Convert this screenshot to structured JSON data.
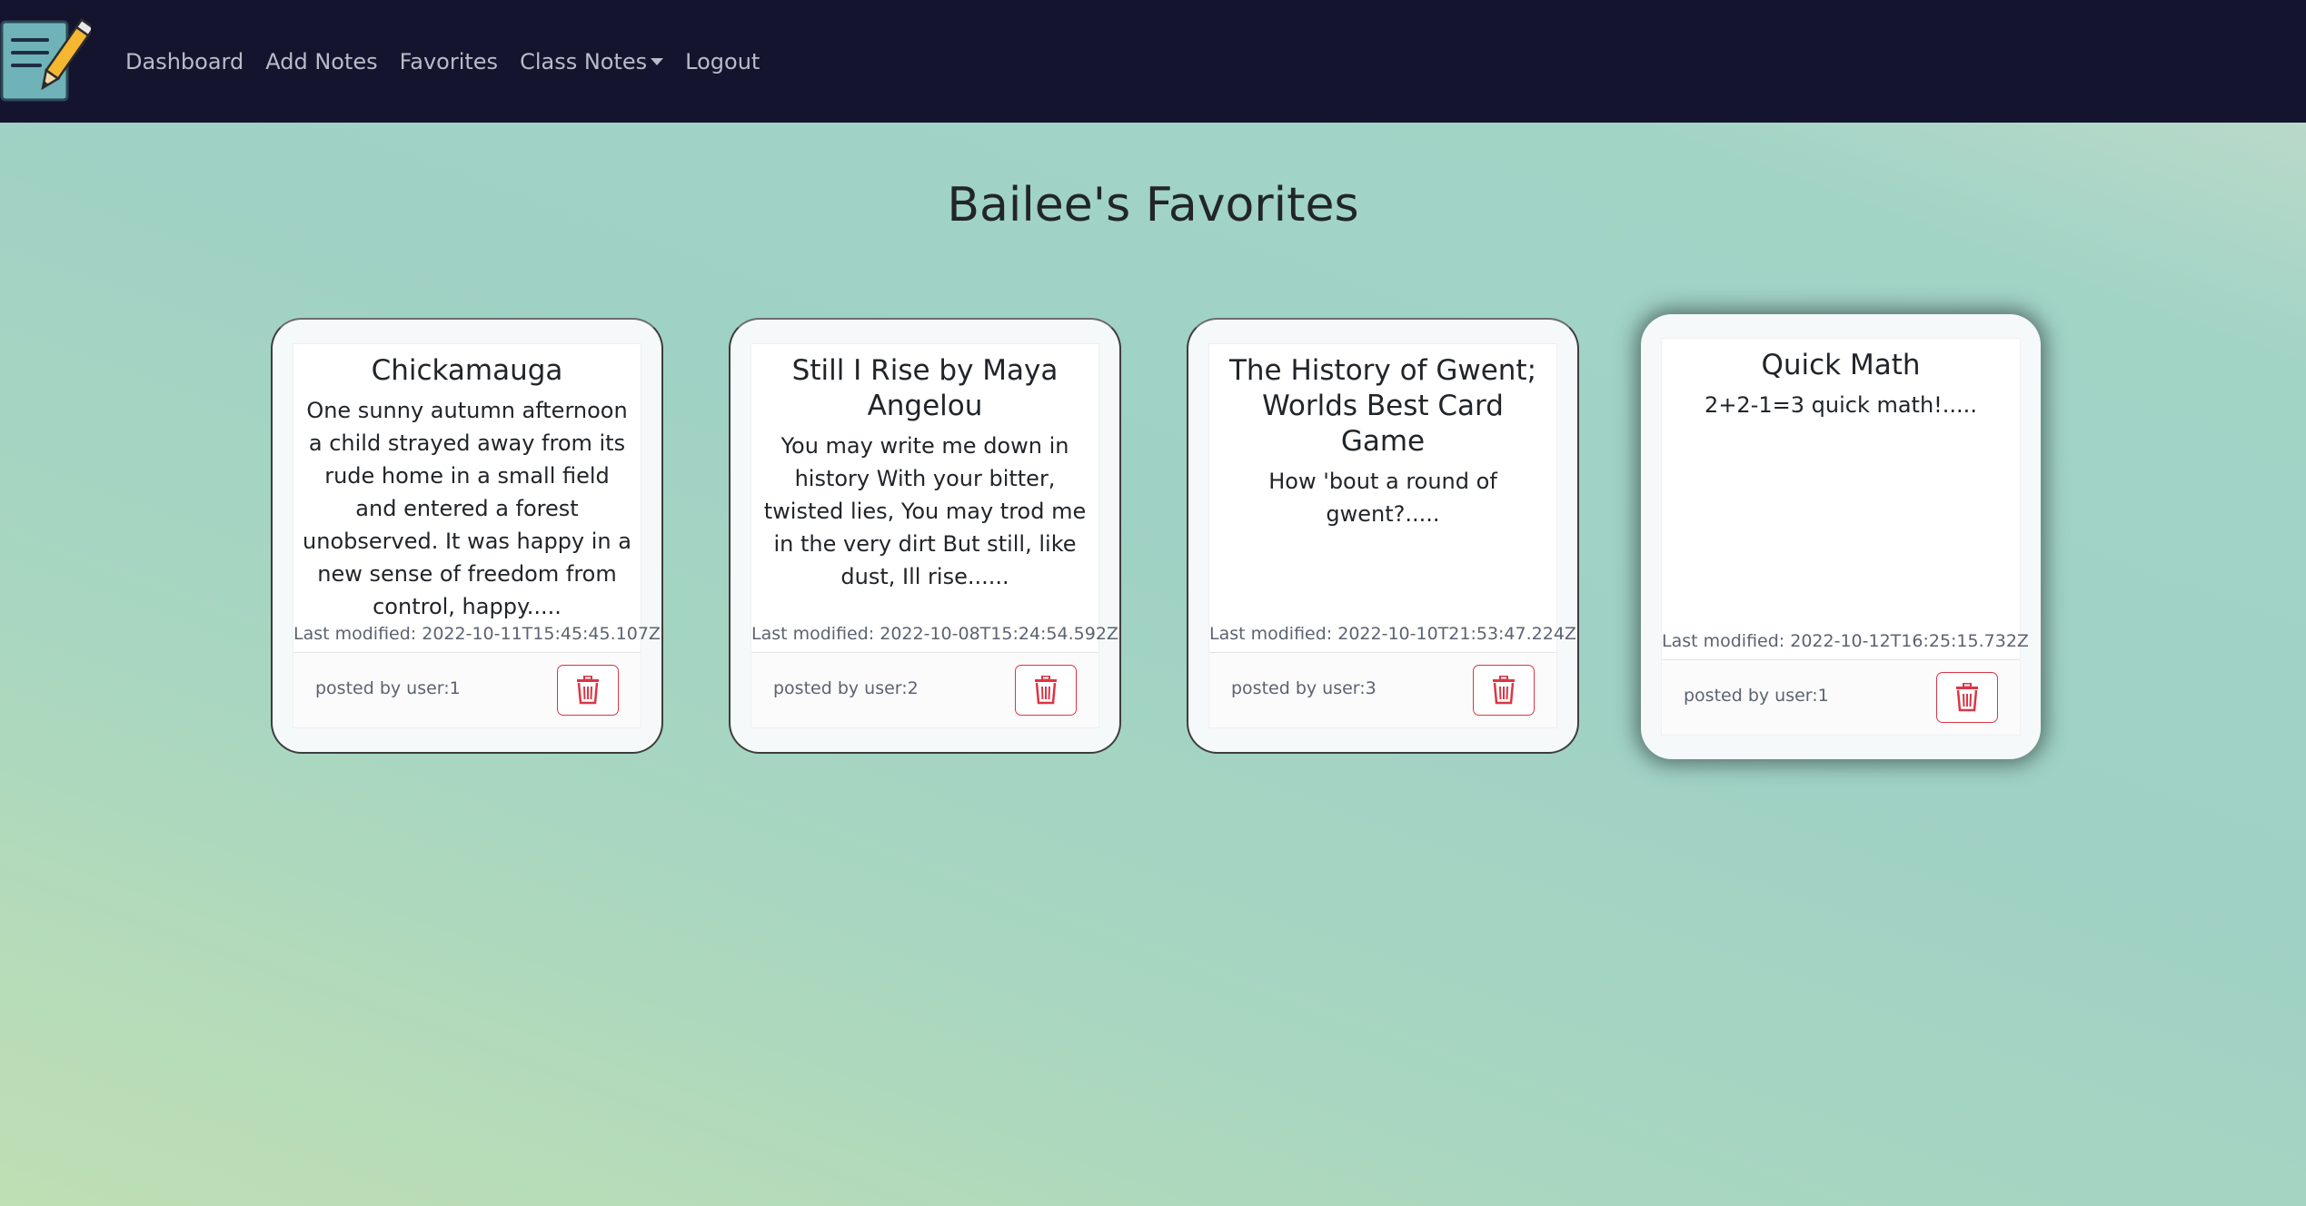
{
  "nav": {
    "logo_icon": "notepad-pencil-icon",
    "links": {
      "dashboard": "Dashboard",
      "add_notes": "Add Notes",
      "favorites": "Favorites",
      "class_notes": "Class Notes",
      "logout": "Logout"
    }
  },
  "page": {
    "title": "Bailee's Favorites"
  },
  "cards": [
    {
      "title": "Chickamauga",
      "text": "One sunny autumn afternoon a child strayed away from its rude home in a small field and entered a forest unobserved. It was happy in a new sense of freedom from control, happy.....",
      "last_modified": "Last modified: 2022-10-11T15:45:45.107Z",
      "posted_by": "posted by user:1",
      "delete_icon": "trash-icon"
    },
    {
      "title": "Still I Rise by Maya Angelou",
      "text": "You may write me down in history With your bitter, twisted lies, You may trod me in the very dirt But still, like dust, Ill rise......",
      "last_modified": "Last modified: 2022-10-08T15:24:54.592Z",
      "posted_by": "posted by user:2",
      "delete_icon": "trash-icon"
    },
    {
      "title": "The History of Gwent; Worlds Best Card Game",
      "text": "How 'bout a round of gwent?.....",
      "last_modified": "Last modified: 2022-10-10T21:53:47.224Z",
      "posted_by": "posted by user:3",
      "delete_icon": "trash-icon"
    },
    {
      "title": "Quick Math",
      "text": "2+2-1=3 quick math!.....",
      "last_modified": "Last modified: 2022-10-12T16:25:15.732Z",
      "posted_by": "posted by user:1",
      "delete_icon": "trash-icon"
    }
  ],
  "colors": {
    "navbar_bg": "#15142f",
    "nav_link": "#b8bcc7",
    "delete_red": "#dc3545",
    "background_teal": "#9fd1c5"
  }
}
